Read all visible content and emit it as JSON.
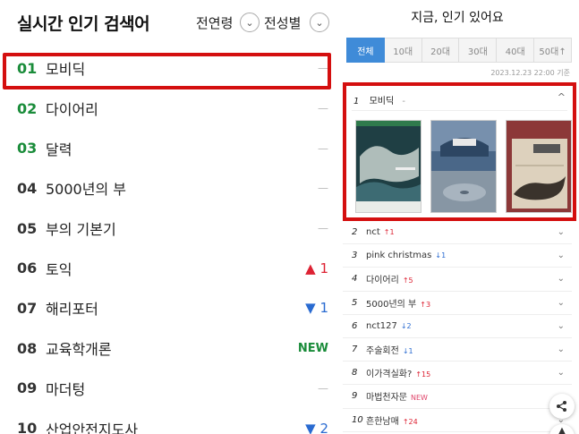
{
  "left": {
    "title": "실시간 인기 검색어",
    "filter_age": "전연령",
    "filter_gender": "전성별",
    "items": [
      {
        "rank": "01",
        "keyword": "모비딕",
        "change": "—",
        "type": "same"
      },
      {
        "rank": "02",
        "keyword": "다이어리",
        "change": "—",
        "type": "same"
      },
      {
        "rank": "03",
        "keyword": "달력",
        "change": "—",
        "type": "same"
      },
      {
        "rank": "04",
        "keyword": "5000년의 부",
        "change": "—",
        "type": "same"
      },
      {
        "rank": "05",
        "keyword": "부의 기본기",
        "change": "—",
        "type": "same"
      },
      {
        "rank": "06",
        "keyword": "토익",
        "change": "▲ 1",
        "type": "up"
      },
      {
        "rank": "07",
        "keyword": "해리포터",
        "change": "▼ 1",
        "type": "down"
      },
      {
        "rank": "08",
        "keyword": "교육학개론",
        "change": "NEW",
        "type": "new"
      },
      {
        "rank": "09",
        "keyword": "마더텅",
        "change": "—",
        "type": "same"
      },
      {
        "rank": "10",
        "keyword": "산업안전지도사",
        "change": "▼ 2",
        "type": "down"
      }
    ]
  },
  "right": {
    "title": "지금, 인기 있어요",
    "tabs": [
      "전체",
      "10대",
      "20대",
      "30대",
      "40대",
      "50대↑"
    ],
    "date": "2023.12.23 22:00 기준",
    "detail": {
      "num": "1",
      "keyword": "모비딕",
      "change": "-"
    },
    "items": [
      {
        "num": "2",
        "keyword": "nct",
        "change": "↑1",
        "type": "up"
      },
      {
        "num": "3",
        "keyword": "pink christmas",
        "change": "↓1",
        "type": "down"
      },
      {
        "num": "4",
        "keyword": "다이어리",
        "change": "↑5",
        "type": "up"
      },
      {
        "num": "5",
        "keyword": "5000년의 부",
        "change": "↑3",
        "type": "up"
      },
      {
        "num": "6",
        "keyword": "nct127",
        "change": "↓2",
        "type": "down"
      },
      {
        "num": "7",
        "keyword": "주술회전",
        "change": "↓1",
        "type": "down"
      },
      {
        "num": "8",
        "keyword": "이가격실화?",
        "change": "↑15",
        "type": "up"
      },
      {
        "num": "9",
        "keyword": "마법천자문",
        "change": "NEW",
        "type": "new"
      },
      {
        "num": "10",
        "keyword": "흔한남매",
        "change": "↑24",
        "type": "up"
      }
    ]
  },
  "icons": {
    "chevron": "chevron-down-icon",
    "share": "share-icon",
    "top": "scroll-top-icon"
  },
  "colors": {
    "highlight": "#d40f0f",
    "green_rank": "#1a8c3a",
    "up": "#dd2233",
    "down": "#2a6bd1",
    "active_tab": "#3f8bd8"
  }
}
